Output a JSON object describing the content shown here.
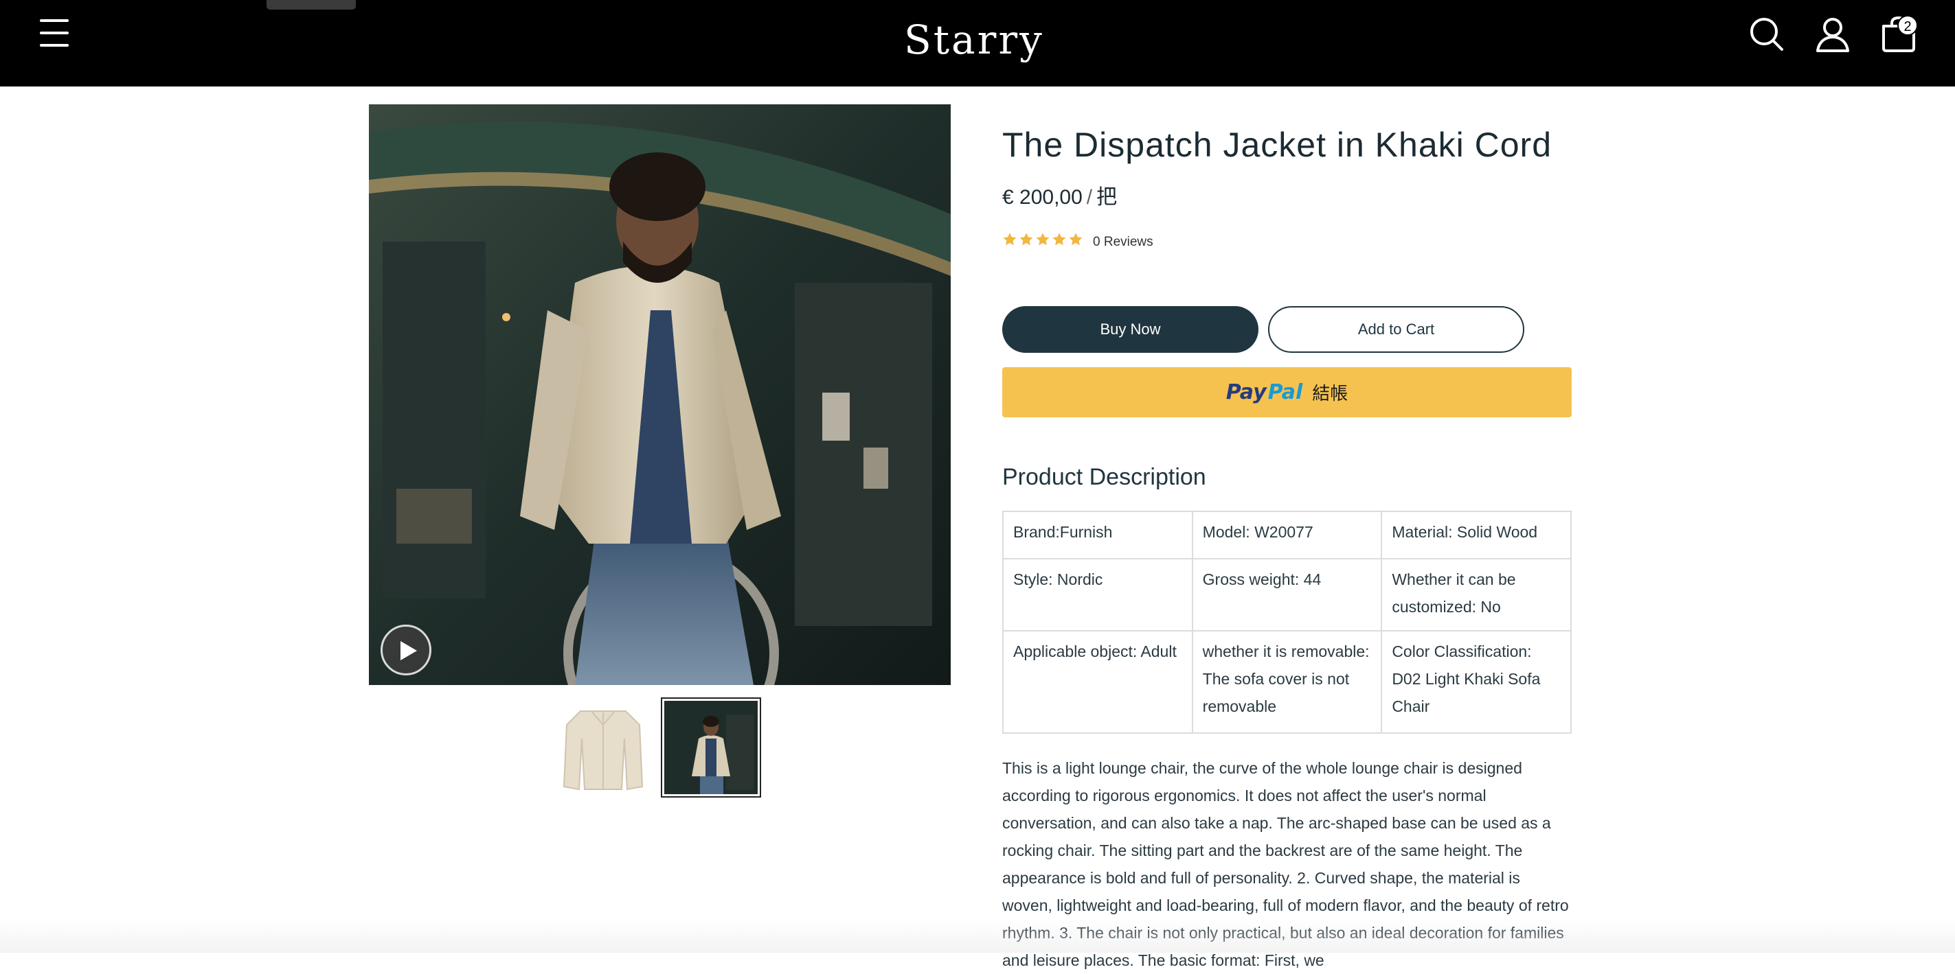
{
  "header": {
    "logo": "Starry",
    "menu_icon": "hamburger-menu-icon",
    "search_icon": "search-icon",
    "account_icon": "user-icon",
    "cart_icon": "shopping-bag-icon",
    "cart_count": "2"
  },
  "gallery": {
    "main_image": "man-in-khaki-cord-jacket-photo",
    "play_icon": "play-icon",
    "thumbnails": [
      "khaki-jacket-flat-thumbnail",
      "model-wearing-jacket-thumbnail"
    ],
    "selected_thumbnail": 2
  },
  "product": {
    "title": "The Dispatch Jacket in Khaki Cord",
    "price": "€ 200,00",
    "price_separator": "/",
    "price_unit": "把",
    "rating": 5,
    "reviews_label": "0 Reviews",
    "buy_now_label": "Buy Now",
    "add_to_cart_label": "Add to Cart",
    "paypal": {
      "brand_pay": "Pay",
      "brand_pal": "Pal",
      "checkout_label": "結帳"
    }
  },
  "description": {
    "title": "Product Description",
    "specs": [
      [
        "Brand:Furnish",
        "Model: W20077",
        "Material: Solid Wood"
      ],
      [
        "Style: Nordic",
        "Gross weight: 44",
        "Whether it can be customized: No"
      ],
      [
        "Applicable object: Adult",
        "whether it is removable: The sofa cover is not removable",
        "Color Classification: D02 Light Khaki Sofa Chair"
      ]
    ],
    "body": "This is a light lounge chair, the curve of the whole lounge chair is designed according to rigorous ergonomics. It does not affect the user's normal conversation, and can also take a nap. The arc-shaped base can be used as a rocking chair. The sitting part and the backrest are of the same height. The appearance is bold and full of personality. 2. Curved shape, the material is woven, lightweight and load-bearing, full of modern flavor, and the beauty of retro rhythm. 3. The chair is not only practical, but also an ideal decoration for families and leisure places. The basic format: First, we"
  },
  "colors": {
    "header_bg": "#000000",
    "primary_dark": "#1f3540",
    "paypal_yellow": "#f6c24f",
    "star_gold": "#f3b63f",
    "border_gray": "#dcdcdc"
  }
}
